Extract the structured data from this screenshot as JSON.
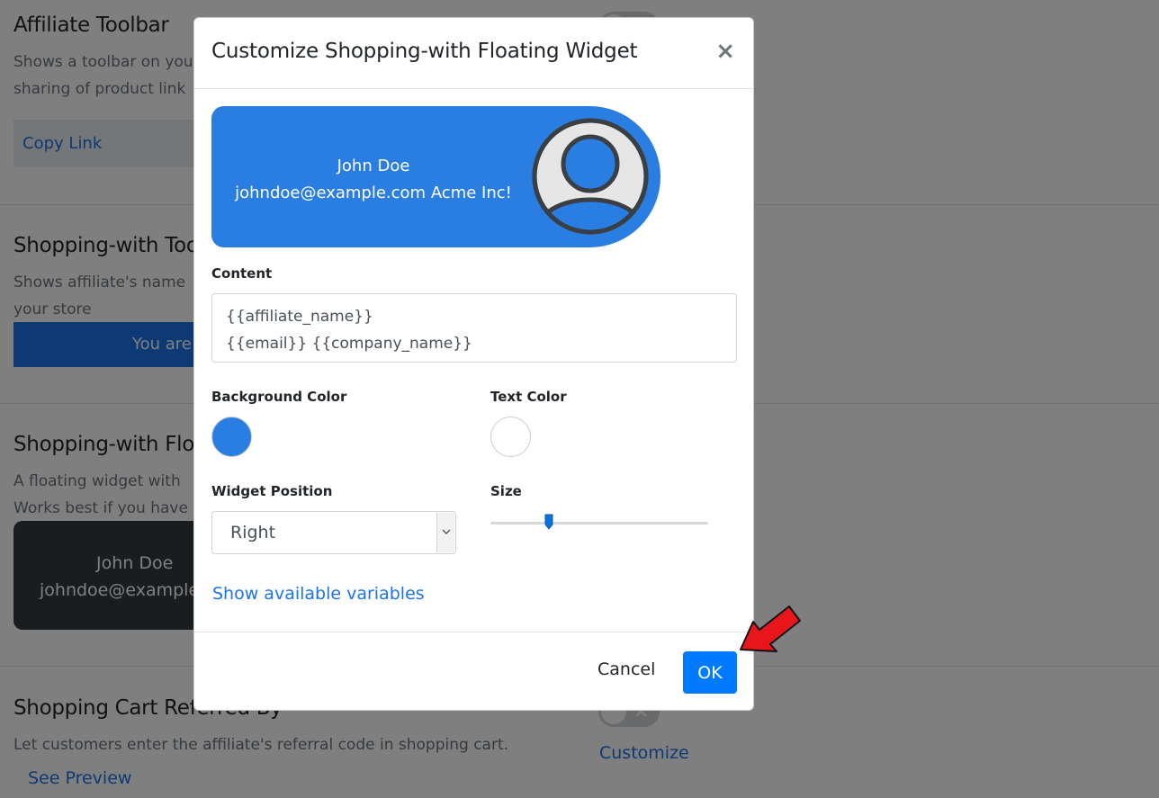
{
  "background": {
    "sections": [
      {
        "title": "Affiliate Toolbar",
        "desc_lines": [
          "Shows a toolbar on you",
          "sharing of product link"
        ],
        "preview_link": "Copy Link"
      },
      {
        "title": "Shopping-with Too",
        "desc_lines": [
          "Shows affiliate's name",
          "your store"
        ],
        "preview_text": "You are"
      },
      {
        "title": "Shopping-with Flo",
        "desc_lines": [
          "A floating widget with",
          "Works best if you have"
        ],
        "widget_line1": "John Doe",
        "widget_line2": "johndoe@example."
      },
      {
        "title": "Shopping Cart Referred By",
        "desc_lines": [
          "Let customers enter the affiliate's referral code in shopping cart."
        ],
        "see_preview": "See Preview",
        "customize": "Customize"
      }
    ]
  },
  "modal": {
    "title": "Customize Shopping-with Floating Widget",
    "close_symbol": "×",
    "preview": {
      "line1": "John Doe",
      "line2": "johndoe@example.com Acme Inc!",
      "background_color": "#2a7de1",
      "avatar_icon": "user-avatar-icon"
    },
    "content": {
      "label": "Content",
      "line1": "{{affiliate_name}}",
      "line2": "{{email}} {{company_name}}"
    },
    "background_color": {
      "label": "Background Color",
      "value": "#2a7de1"
    },
    "text_color": {
      "label": "Text Color",
      "value": "#ffffff"
    },
    "widget_position": {
      "label": "Widget Position",
      "selected": "Right"
    },
    "size": {
      "label": "Size",
      "value_fraction": 0.26
    },
    "variables_link": "Show available variables",
    "cancel_label": "Cancel",
    "ok_label": "OK",
    "annotation_color": "#e8161b"
  }
}
